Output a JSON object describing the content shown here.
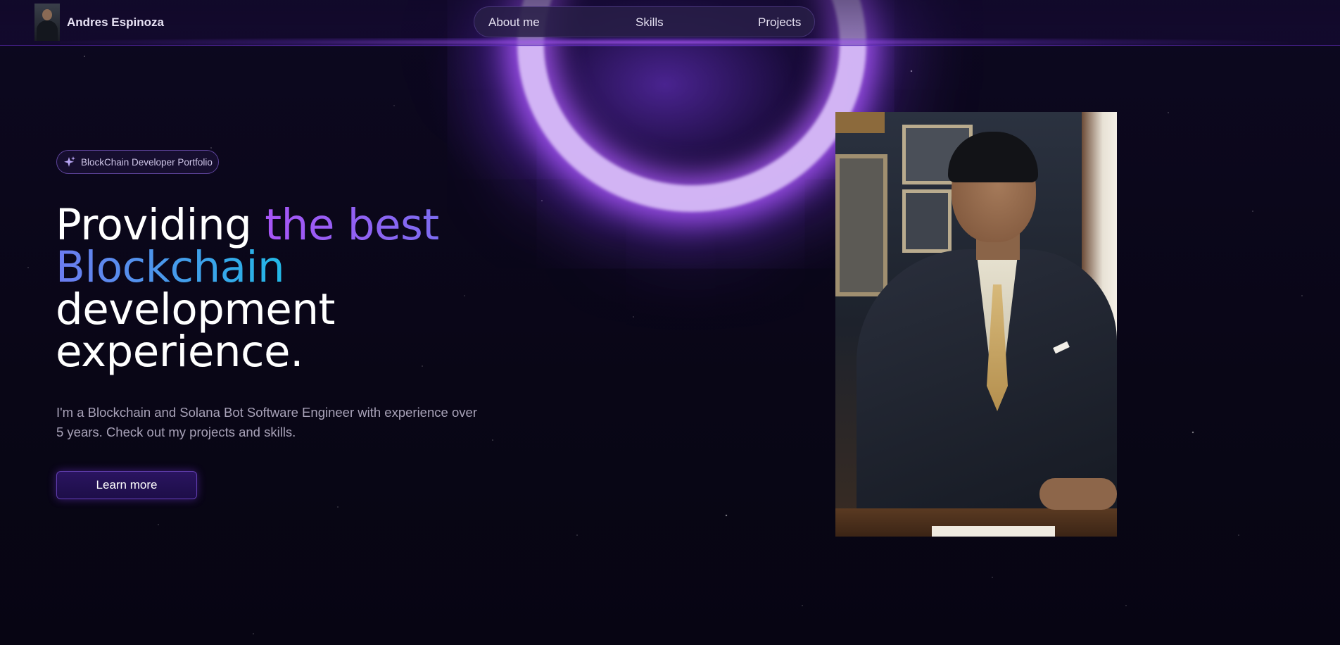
{
  "header": {
    "brand_name": "Andres Espinoza",
    "nav": [
      {
        "label": "About me"
      },
      {
        "label": "Skills"
      },
      {
        "label": "Projects"
      }
    ]
  },
  "hero": {
    "badge": {
      "icon": "sparkles-icon",
      "text": "BlockChain Developer Portfolio"
    },
    "headline": {
      "part1": "Providing ",
      "part2": "the best",
      "part3": "Blockchain",
      "part4": "development",
      "part5": "experience."
    },
    "description": "I'm a Blockchain and Solana Bot Software Engineer with experience over 5 years. Check out my projects and skills.",
    "cta_label": "Learn more"
  },
  "colors": {
    "background": "#0b0718",
    "accent_purple": "#a855f7",
    "accent_blue": "#22b8e6",
    "button_bg": "#2a1460"
  }
}
